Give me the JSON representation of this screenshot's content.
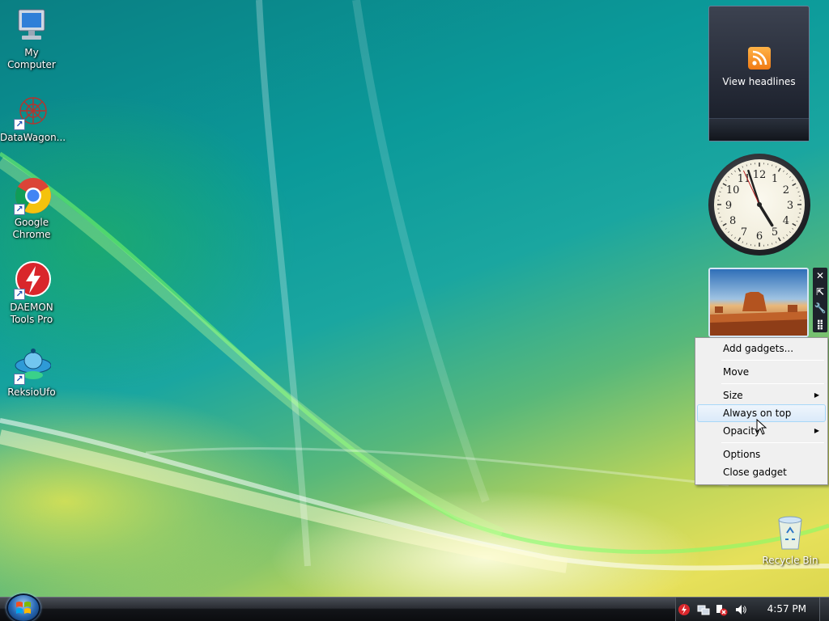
{
  "desktop": {
    "icons": [
      {
        "label": "My Computer",
        "icon": "computer-icon"
      },
      {
        "label": "DataWagon...",
        "icon": "datawagon-icon"
      },
      {
        "label": "Google Chrome",
        "icon": "chrome-icon"
      },
      {
        "label": "DAEMON Tools Pro",
        "icon": "daemon-tools-icon"
      },
      {
        "label": "ReksioUfo",
        "icon": "reksioufo-icon"
      }
    ],
    "recycle_bin": {
      "label": "Recycle Bin",
      "icon": "recycle-bin-icon"
    }
  },
  "gadgets": {
    "feed": {
      "label": "View headlines",
      "icon": "rss-icon"
    },
    "clock": {
      "numbers": [
        "12",
        "1",
        "2",
        "3",
        "4",
        "5",
        "6",
        "7",
        "8",
        "9",
        "10",
        "11"
      ]
    },
    "slideshow": {
      "icon": "desert-photo"
    },
    "controls": {
      "close": "✕",
      "size": "⇱",
      "options": "🔧",
      "drag": "⣿"
    }
  },
  "context_menu": {
    "items": [
      {
        "label": "Add gadgets...",
        "submenu": false
      },
      {
        "label": "Move",
        "submenu": false
      },
      {
        "label": "Size",
        "submenu": true
      },
      {
        "label": "Always on top",
        "submenu": false,
        "highlighted": true
      },
      {
        "label": "Opacity",
        "submenu": true
      },
      {
        "label": "Options",
        "submenu": false
      },
      {
        "label": "Close gadget",
        "submenu": false
      }
    ]
  },
  "taskbar": {
    "start_icon": "windows-logo",
    "time": "4:57 PM",
    "tray_icons": [
      "daemon-tray-icon",
      "network-icon",
      "security-alert-icon",
      "volume-icon"
    ]
  }
}
